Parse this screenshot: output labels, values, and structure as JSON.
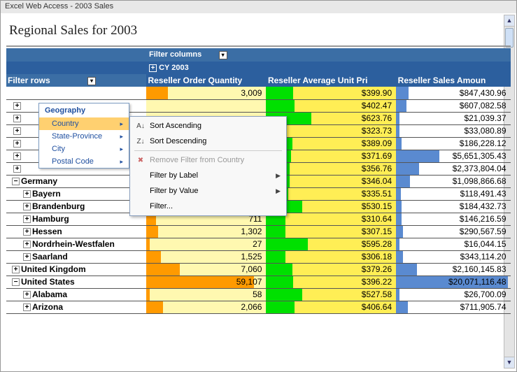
{
  "app_title": "Excel Web Access - 2003 Sales",
  "page_title": "Regional Sales for 2003",
  "pivot": {
    "filter_columns_label": "Filter columns",
    "cy_label": "CY 2003",
    "filter_rows_label": "Filter rows",
    "col_headers": [
      "Reseller Order Quantity",
      "Reseller Average Unit Pri",
      "Reseller Sales Amoun"
    ]
  },
  "rows": [
    {
      "level": 1,
      "exp": "−",
      "label": "Germany",
      "qty": "",
      "avg": "$346.04",
      "bar_avg": 18,
      "sales": "$1,098,866.68",
      "bar_sales": 12
    },
    {
      "level": 2,
      "exp": "+",
      "label": "Bayern",
      "qty": "",
      "avg": "$335.51",
      "bar_avg": 17,
      "sales": "$118,491.43",
      "bar_sales": 4
    },
    {
      "level": 2,
      "exp": "+",
      "label": "Brandenburg",
      "qty": "",
      "avg": "$530.15",
      "bar_avg": 28,
      "sales": "$184,432.73",
      "bar_sales": 5,
      "qty_bar": 4
    },
    {
      "level": 2,
      "exp": "+",
      "label": "Hamburg",
      "qty": "711",
      "qty_bar": 8,
      "avg": "$310.64",
      "bar_avg": 15,
      "sales": "$146,216.59",
      "bar_sales": 5
    },
    {
      "level": 2,
      "exp": "+",
      "label": "Hessen",
      "qty": "1,302",
      "qty_bar": 10,
      "avg": "$307.15",
      "bar_avg": 15,
      "sales": "$290,567.59",
      "bar_sales": 6
    },
    {
      "level": 2,
      "exp": "+",
      "label": "Nordrhein-Westfalen",
      "qty": "27",
      "qty_bar": 3,
      "avg": "$595.28",
      "bar_avg": 32,
      "sales": "$16,044.15",
      "bar_sales": 3
    },
    {
      "level": 2,
      "exp": "+",
      "label": "Saarland",
      "qty": "1,525",
      "qty_bar": 12,
      "avg": "$306.18",
      "bar_avg": 15,
      "sales": "$343,114.20",
      "bar_sales": 6
    },
    {
      "level": 1,
      "exp": "+",
      "label": "United Kingdom",
      "qty": "7,060",
      "qty_bar": 28,
      "avg": "$379.26",
      "bar_avg": 20,
      "sales": "$2,160,145.83",
      "bar_sales": 18
    },
    {
      "level": 1,
      "exp": "−",
      "label": "United States",
      "qty": "59,107",
      "qty_bar": 90,
      "avg": "$396.22",
      "bar_avg": 21,
      "sales": "$20,071,116.48",
      "bar_sales": 98
    },
    {
      "level": 2,
      "exp": "+",
      "label": "Alabama",
      "qty": "58",
      "qty_bar": 3,
      "avg": "$527.58",
      "bar_avg": 28,
      "sales": "$26,700.09",
      "bar_sales": 3
    },
    {
      "level": 2,
      "exp": "+",
      "label": "Arizona",
      "qty": "2,066",
      "qty_bar": 14,
      "avg": "$406.64",
      "bar_avg": 22,
      "sales": "$711,905.74",
      "bar_sales": 10
    }
  ],
  "hidden_rows": [
    {
      "qty": "3,009",
      "qty_bar": 18,
      "avg": "$399.90",
      "bar_avg": 21,
      "sales": "$847,430.96",
      "bar_sales": 11
    },
    {
      "qty": "",
      "qty_bar": 0,
      "avg": "$402.47",
      "bar_avg": 22,
      "sales": "$607,082.58",
      "bar_sales": 9
    },
    {
      "qty": "",
      "qty_bar": 0,
      "avg": "$623.76",
      "bar_avg": 35,
      "sales": "$21,039.37",
      "bar_sales": 3
    },
    {
      "qty": "",
      "qty_bar": 0,
      "avg": "$323.73",
      "bar_avg": 16,
      "sales": "$33,080.89",
      "bar_sales": 3
    },
    {
      "qty": "",
      "qty_bar": 0,
      "avg": "$389.09",
      "bar_avg": 20,
      "sales": "$186,228.12",
      "bar_sales": 5
    },
    {
      "qty": "",
      "qty_bar": 0,
      "avg": "$371.69",
      "bar_avg": 19,
      "sales": "$5,651,305.43",
      "bar_sales": 38
    },
    {
      "qty": "",
      "qty_bar": 0,
      "avg": "$356.76",
      "bar_avg": 18,
      "sales": "$2,373,804.04",
      "bar_sales": 20
    }
  ],
  "hier_menu": {
    "title": "Geography",
    "items": [
      "Country",
      "State-Province",
      "City",
      "Postal Code"
    ],
    "selected": 0
  },
  "ctx_menu": {
    "sort_asc": "Sort Ascending",
    "sort_desc": "Sort Descending",
    "remove": "Remove Filter from Country",
    "by_label": "Filter by Label",
    "by_value": "Filter by Value",
    "filter": "Filter..."
  }
}
